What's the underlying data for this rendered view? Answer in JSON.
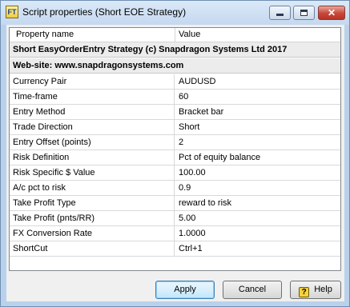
{
  "window": {
    "title": "Script properties (Short EOE Strategy)",
    "app_icon_text": "FT",
    "close_glyph": "✕"
  },
  "grid": {
    "header": {
      "name": "Property name",
      "value": "Value"
    },
    "banners": [
      "Short EasyOrderEntry Strategy (c) Snapdragon Systems Ltd 2017",
      "Web-site: www.snapdragonsystems.com"
    ],
    "rows": [
      {
        "name": "Currency Pair",
        "value": "AUDUSD"
      },
      {
        "name": "Time-frame",
        "value": "60"
      },
      {
        "name": "Entry Method",
        "value": "Bracket bar"
      },
      {
        "name": "Trade Direction",
        "value": "Short"
      },
      {
        "name": "Entry Offset (points)",
        "value": "2"
      },
      {
        "name": "Risk Definition",
        "value": "Pct of equity balance"
      },
      {
        "name": "Risk Specific $ Value",
        "value": "100.00"
      },
      {
        "name": "A/c pct to risk",
        "value": "0.9"
      },
      {
        "name": "Take Profit Type",
        "value": "reward to risk"
      },
      {
        "name": "Take Profit (pnts/RR)",
        "value": "5.00"
      },
      {
        "name": "FX Conversion Rate",
        "value": "1.0000"
      },
      {
        "name": "ShortCut",
        "value": "Ctrl+1"
      }
    ]
  },
  "buttons": {
    "apply": "Apply",
    "cancel": "Cancel",
    "help": "Help",
    "help_icon_glyph": "?"
  }
}
